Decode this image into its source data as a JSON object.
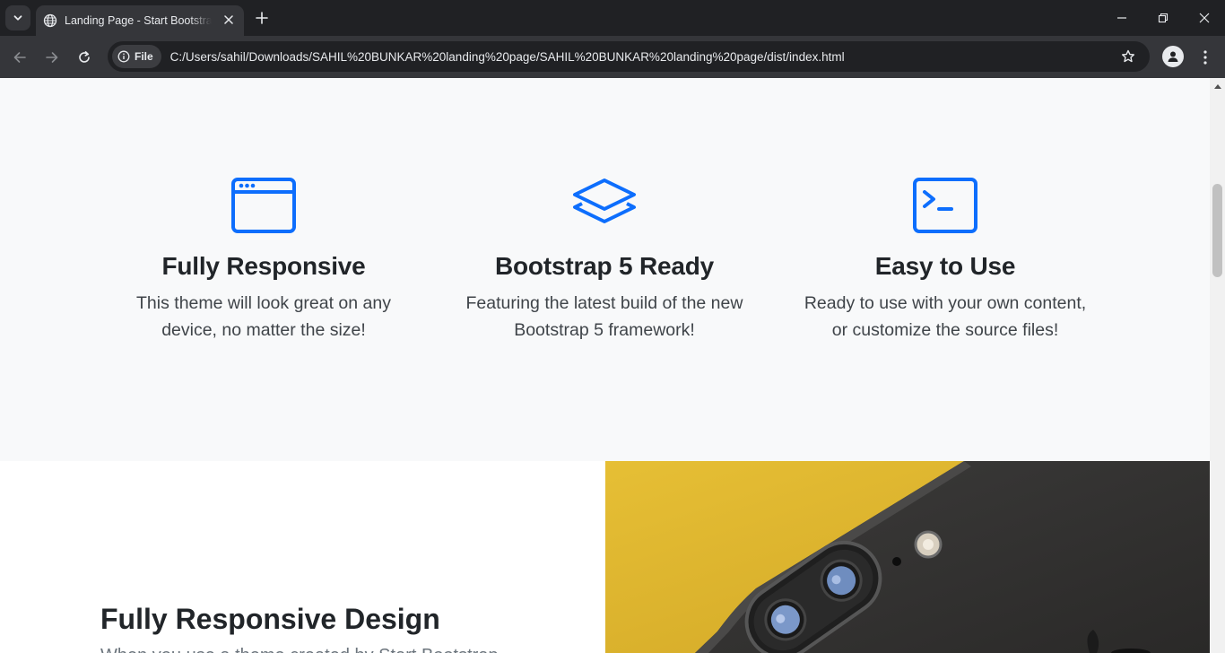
{
  "browser": {
    "tab_title": "Landing Page - Start Bootstrap Theme",
    "site_chip": "File",
    "url": "C:/Users/sahil/Downloads/SAHIL%20BUNKAR%20landing%20page/SAHIL%20BUNKAR%20landing%20page/dist/index.html",
    "accent": "#202124"
  },
  "features": {
    "icon_color": "#0d6efd",
    "items": [
      {
        "icon": "window-icon",
        "title": "Fully Responsive",
        "text_line1": "This theme will look great on any",
        "text_line2": "device, no matter the size!"
      },
      {
        "icon": "layers-icon",
        "title": "Bootstrap 5 Ready",
        "text_line1": "Featuring the latest build of the new",
        "text_line2": "Bootstrap 5 framework!"
      },
      {
        "icon": "terminal-icon",
        "title": "Easy to Use",
        "text_line1": "Ready to use with your own content,",
        "text_line2": "or customize the source files!"
      }
    ]
  },
  "showcase": {
    "title": "Fully Responsive Design",
    "subtitle": "When you use a theme created by Start Bootstrap,"
  },
  "scroll": {
    "position_fraction": 0.2
  }
}
